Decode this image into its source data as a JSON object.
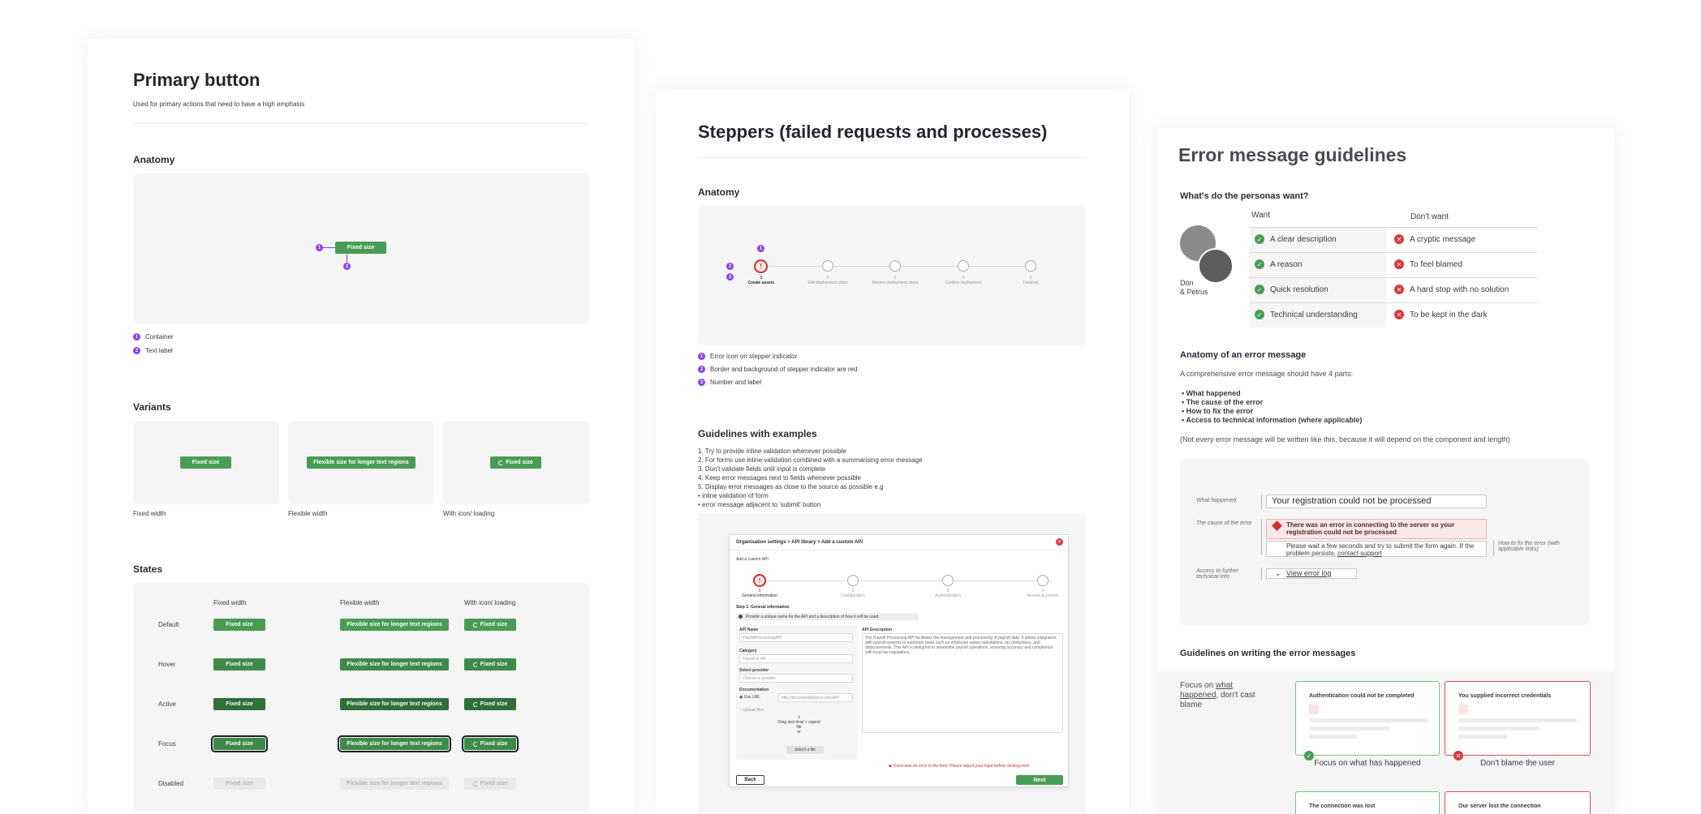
{
  "card1": {
    "title": "Primary button",
    "subtitle": "Used for primary actions that need to have a high emphasis",
    "anatomy_heading": "Anatomy",
    "anatomy_button": "Fixed size",
    "legend": [
      {
        "num": "1",
        "label": "Container"
      },
      {
        "num": "2",
        "label": "Text label"
      }
    ],
    "variants_heading": "Variants",
    "variants": [
      {
        "button": "Fixed size",
        "caption": "Fixed width"
      },
      {
        "button": "Flexible size for longer text regions",
        "caption": "Flexible width"
      },
      {
        "button": "Fixed size",
        "caption": "With icon/ loading"
      }
    ],
    "states_heading": "States",
    "states_columns": [
      "Fixed width",
      "Flexible width",
      "With icon/ loading"
    ],
    "states_rows": [
      "Default",
      "Hover",
      "Active",
      "Focus",
      "Disabled"
    ],
    "state_fixed": "Fixed size",
    "state_flex": "Flexible size for longer text regions"
  },
  "card2": {
    "title": "Steppers (failed requests and processes)",
    "anatomy_heading": "Anatomy",
    "steps": [
      {
        "num": "1",
        "label": "Create assets"
      },
      {
        "num": "2",
        "label": "Edit deployment steps"
      },
      {
        "num": "3",
        "label": "Review deployment steps"
      },
      {
        "num": "4",
        "label": "Confirm deployment"
      },
      {
        "num": "5",
        "label": "Finished"
      }
    ],
    "error_glyph": "!",
    "legend": [
      {
        "num": "1",
        "label": "Error icon on stepper indicator"
      },
      {
        "num": "2",
        "label": "Border and background of stepper indicator are red"
      },
      {
        "num": "3",
        "label": "Number and label"
      }
    ],
    "guidelines_heading": "Guidelines with examples",
    "guidelines": [
      "1. Try to provide inline validation whenever possible",
      "2. For forms use inline validation combined with a summarising error message",
      "3. Don't validate fields until input is complete",
      "4. Keep error messages next to fields whenever possible",
      "5. Display error messages as close to the source as possible e.g",
      "• inline validation of form",
      "• error message adjacent to 'submit' button"
    ],
    "mock": {
      "breadcrumb": "Organisation settings > API library > Add a custom API",
      "subtitle": "Add a custom API",
      "steps": [
        {
          "num": "1",
          "label": "General information"
        },
        {
          "num": "2",
          "label": "Configuration"
        },
        {
          "num": "3",
          "label": "Authentication"
        },
        {
          "num": "4",
          "label": "Review & confirm"
        }
      ],
      "step_title": "Step 1: General information",
      "info": "Provide a unique name for the API and a description of how it will be used.",
      "api_name_label": "API Name",
      "api_name_value": "PayrollProcessingAPI",
      "category_label": "Category",
      "category_value": "Payroll & HR",
      "provider_label": "Select provider",
      "provider_value": "Choose a provider",
      "doc_label": "Documentation",
      "use_url": "Use URL",
      "url_value": "http://documentationurl.com/API",
      "upload": "Upload files",
      "drag_text": "Drag and drop + zipped file",
      "or_text": "or",
      "select_file": "Select a file",
      "desc_label": "API Description",
      "desc_value": "The Payroll Processing API facilitates the management and processing of payroll data. It allows integration with payroll systems to automate tasks such as employee salary calculations, tax deductions, and disbursements. This API is designed to streamline payroll operations, ensuring accuracy and compliance with local tax regulations.",
      "error": "There was an error in the form. Please adjust your input before clicking next",
      "back": "Back",
      "next": "Next"
    }
  },
  "card3": {
    "title": "Error message guidelines",
    "personas_heading": "What's do the personas want?",
    "persona_names": "Don\n& Petrus",
    "want_heading": "Want",
    "dont_heading": "Don't want",
    "wants": [
      "A clear description",
      "A reason",
      "Quick resolution",
      "Technical understanding"
    ],
    "donts": [
      "A cryptic message",
      "To feel blamed",
      "A hard stop with no solution",
      "To be kept in the dark"
    ],
    "anatomy_heading": "Anatomy of an error message",
    "anatomy_intro": "A comprehensive error message should have 4 parts:",
    "parts": [
      "What happened",
      "The cause of the error",
      "How to fix the error",
      "Access to technical information (where applicable)"
    ],
    "note": "(Not every error message will be written like this, because it will depend on the component and length)",
    "example": {
      "what_label": "What happened",
      "what_text": "Your registration could not be processed",
      "cause_label": "The cause of the error",
      "cause_text": "There was an error in connecting to the server so your registration could not be processed",
      "fix_text_pre": "Please wait a few seconds and try to submit the form again. If the problem persists,",
      "fix_link": "contact support",
      "fix_label": "How to fix the error (with applicable links)",
      "tech_label": "Access to further technical info",
      "tech_link": "View error log"
    },
    "writing_heading": "Guidelines on writing the error messages",
    "focus_pre": "Focus on",
    "focus_link": "what happened",
    "focus_post": ", don't cast blame",
    "good_card": "Authentication could not be completed",
    "bad_card": "You supplied incorrect credentials",
    "good_caption": "Focus on what has happened",
    "bad_caption": "Don't blame the user",
    "good_card2": "The connection was lost",
    "bad_card2": "Our server lost the connection"
  }
}
